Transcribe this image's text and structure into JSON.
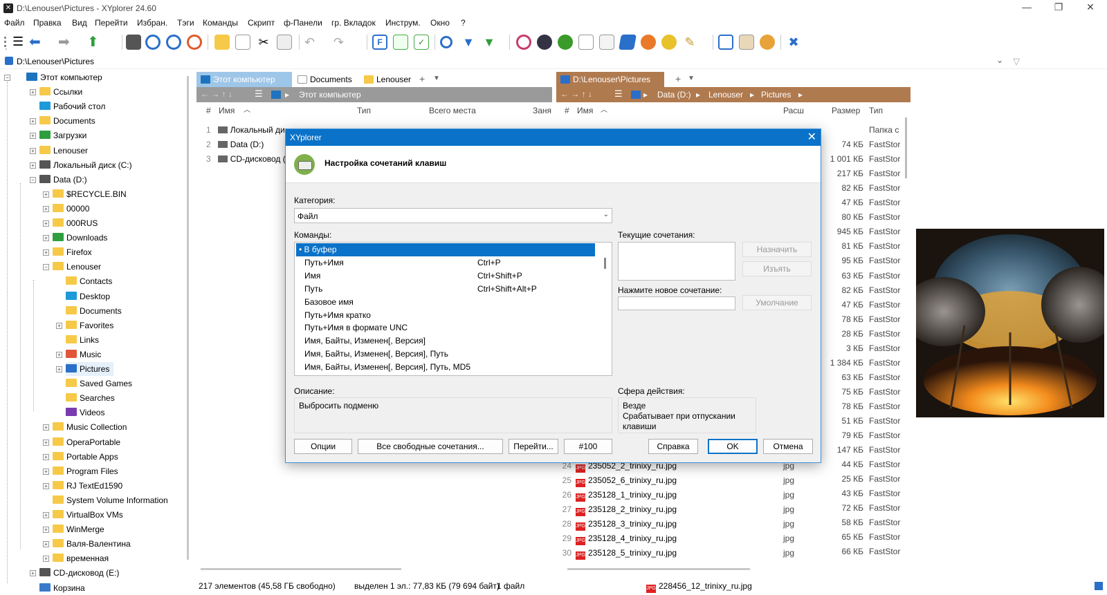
{
  "window": {
    "title": "D:\\Lenouser\\Pictures - XYplorer 24.60"
  },
  "menu": [
    "Файл",
    "Правка",
    "Вид",
    "Перейти",
    "Избран.",
    "Тэги",
    "Команды",
    "Скрипт",
    "ф-Панели",
    "гр. Вкладок",
    "Инструм.",
    "Окно",
    "?"
  ],
  "address": {
    "path": "D:\\Lenouser\\Pictures"
  },
  "tree": [
    {
      "label": "Этот компьютер",
      "level": 0,
      "icon": "computer"
    },
    {
      "label": "Ссылки",
      "level": 1,
      "icon": "folder"
    },
    {
      "label": "Рабочий стол",
      "level": 1,
      "icon": "desktop"
    },
    {
      "label": "Documents",
      "level": 1,
      "icon": "folder"
    },
    {
      "label": "Загрузки",
      "level": 1,
      "icon": "download"
    },
    {
      "label": "Lenouser",
      "level": 1,
      "icon": "folder"
    },
    {
      "label": "Локальный диск (C:)",
      "level": 1,
      "icon": "drive"
    },
    {
      "label": "Data (D:)",
      "level": 1,
      "icon": "drive"
    },
    {
      "label": "$RECYCLE.BIN",
      "level": 2,
      "icon": "folder"
    },
    {
      "label": "00000",
      "level": 2,
      "icon": "folder"
    },
    {
      "label": "000RUS",
      "level": 2,
      "icon": "folder"
    },
    {
      "label": "Downloads",
      "level": 2,
      "icon": "download"
    },
    {
      "label": "Firefox",
      "level": 2,
      "icon": "folder"
    },
    {
      "label": "Lenouser",
      "level": 2,
      "icon": "folder"
    },
    {
      "label": "Contacts",
      "level": 3,
      "icon": "folder"
    },
    {
      "label": "Desktop",
      "level": 3,
      "icon": "desktop"
    },
    {
      "label": "Documents",
      "level": 3,
      "icon": "folder"
    },
    {
      "label": "Favorites",
      "level": 3,
      "icon": "folder"
    },
    {
      "label": "Links",
      "level": 3,
      "icon": "folder"
    },
    {
      "label": "Music",
      "level": 3,
      "icon": "music"
    },
    {
      "label": "Pictures",
      "level": 3,
      "icon": "pictures",
      "selected": true
    },
    {
      "label": "Saved Games",
      "level": 3,
      "icon": "folder"
    },
    {
      "label": "Searches",
      "level": 3,
      "icon": "folder"
    },
    {
      "label": "Videos",
      "level": 3,
      "icon": "videos"
    },
    {
      "label": "Music Collection",
      "level": 2,
      "icon": "folder"
    },
    {
      "label": "OperaPortable",
      "level": 2,
      "icon": "folder"
    },
    {
      "label": "Portable Apps",
      "level": 2,
      "icon": "folder"
    },
    {
      "label": "Program Files",
      "level": 2,
      "icon": "folder"
    },
    {
      "label": "RJ TextEd1590",
      "level": 2,
      "icon": "folder"
    },
    {
      "label": "System Volume Information",
      "level": 2,
      "icon": "folder"
    },
    {
      "label": "VirtualBox VMs",
      "level": 2,
      "icon": "folder"
    },
    {
      "label": "WinMerge",
      "level": 2,
      "icon": "folder"
    },
    {
      "label": "Валя-Валентина",
      "level": 2,
      "icon": "folder"
    },
    {
      "label": "временная",
      "level": 2,
      "icon": "folder"
    },
    {
      "label": "CD-дисковод (E:)",
      "level": 1,
      "icon": "drive"
    },
    {
      "label": "Корзина",
      "level": 1,
      "icon": "recycle"
    }
  ],
  "left_pane": {
    "tabs": [
      "Этот компьютер",
      "Documents",
      "Lenouser"
    ],
    "crumb": "Этот компьютер",
    "columns": [
      "#",
      "Имя",
      "Тип",
      "Всего места",
      "Заня"
    ],
    "rows": [
      {
        "n": "1",
        "name": "Локальный ди"
      },
      {
        "n": "2",
        "name": "Data (D:)"
      },
      {
        "n": "3",
        "name": "CD-дисковод ("
      }
    ]
  },
  "right_pane": {
    "tab": "D:\\Lenouser\\Pictures",
    "crumbs": [
      "Data (D:)",
      "Lenouser",
      "Pictures"
    ],
    "columns": [
      "#",
      "Имя",
      "Расш",
      "Размер",
      "Тип"
    ],
    "sizes": [
      "",
      "74 КБ",
      "1 001 КБ",
      "217 КБ",
      "82 КБ",
      "47 КБ",
      "80 КБ",
      "945 КБ",
      "81 КБ",
      "95 КБ",
      "63 КБ",
      "82 КБ",
      "47 КБ",
      "78 КБ",
      "28 КБ",
      "3 КБ",
      "1 384 КБ",
      "63 КБ",
      "75 КБ",
      "78 КБ",
      "51 КБ",
      "79 КБ",
      "147 КБ",
      "44 КБ",
      "25 КБ",
      "43 КБ",
      "72 КБ",
      "58 КБ",
      "65 КБ",
      "66 КБ"
    ],
    "types": [
      "Папка с",
      "FastStor"
    ],
    "files": [
      {
        "n": "24",
        "name": "235052_2_trinixy_ru.jpg",
        "ext": "jpg"
      },
      {
        "n": "25",
        "name": "235052_6_trinixy_ru.jpg",
        "ext": "jpg"
      },
      {
        "n": "26",
        "name": "235128_1_trinixy_ru.jpg",
        "ext": "jpg"
      },
      {
        "n": "27",
        "name": "235128_2_trinixy_ru.jpg",
        "ext": "jpg"
      },
      {
        "n": "28",
        "name": "235128_3_trinixy_ru.jpg",
        "ext": "jpg"
      },
      {
        "n": "29",
        "name": "235128_4_trinixy_ru.jpg",
        "ext": "jpg"
      },
      {
        "n": "30",
        "name": "235128_5_trinixy_ru.jpg",
        "ext": "jpg"
      }
    ]
  },
  "status": {
    "items": "217 элементов (45,58 ГБ свободно)",
    "selected": "выделен 1 эл.: 77,83 КБ (79 694 байт)",
    "files": "1 файл",
    "current": "228456_12_trinixy_ru.jpg"
  },
  "dialog": {
    "title": "XYplorer",
    "header": "Настройка сочетаний клавиш",
    "category_label": "Категория:",
    "category_value": "Файл",
    "commands_label": "Команды:",
    "commands": [
      {
        "label": "• В буфер",
        "shortcut": "",
        "selected": true
      },
      {
        "label": "Путь+Имя",
        "shortcut": "Ctrl+P"
      },
      {
        "label": "Имя",
        "shortcut": "Ctrl+Shift+P"
      },
      {
        "label": "Путь",
        "shortcut": "Ctrl+Shift+Alt+P"
      },
      {
        "label": "Базовое имя",
        "shortcut": ""
      },
      {
        "label": "Путь+Имя кратко",
        "shortcut": ""
      },
      {
        "label": "Путь+Имя в формате UNC",
        "shortcut": ""
      },
      {
        "label": "Имя, Байты, Изменен[, Версия]",
        "shortcut": ""
      },
      {
        "label": "Имя, Байты, Изменен[, Версия], Путь",
        "shortcut": ""
      },
      {
        "label": "Имя, Байты, Изменен[, Версия], Путь, MD5",
        "shortcut": ""
      }
    ],
    "current_label": "Текущие сочетания:",
    "new_label": "Нажмите новое сочетание:",
    "assign": "Назначить",
    "remove": "Изъять",
    "default": "Умолчание",
    "description_label": "Описание:",
    "description": "Выбросить подменю",
    "scope_label": "Сфера действия:",
    "scope_line1": "Везде",
    "scope_line2": "Срабатывает при отпускании клавиши",
    "buttons": {
      "options": "Опции",
      "all_free": "Все свободные сочетания...",
      "goto": "Перейти...",
      "number": "#100",
      "help": "Справка",
      "ok": "OK",
      "cancel": "Отмена"
    }
  },
  "colors": {
    "accent": "#0a72c8",
    "right_tab": "#b07a4f",
    "left_crumb": "#9a9a9a",
    "folder": "#f7c948"
  }
}
